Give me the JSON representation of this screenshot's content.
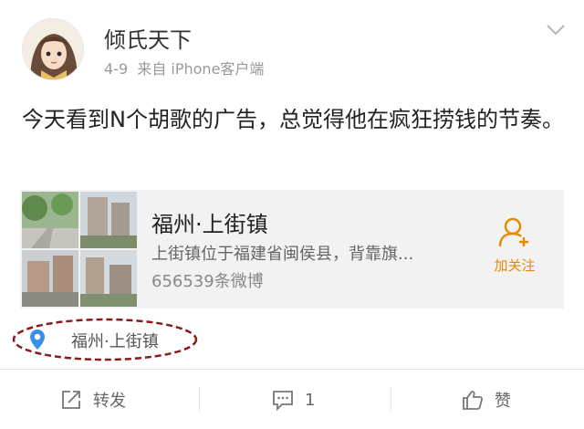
{
  "post": {
    "username": "倾氏天下",
    "date": "4-9",
    "source": "来自 iPhone客户端",
    "text": "今天看到N个胡歌的广告，总觉得他在疯狂捞钱的节奏。",
    "more_icon": "chevron-down-icon"
  },
  "card": {
    "title": "福州·上街镇",
    "description": "上街镇位于福建省闽侯县，背靠旗...",
    "count": "656539条微博",
    "follow_label": "加关注",
    "follow_icon": "add-user-icon"
  },
  "location": {
    "label": "福州·上街镇",
    "icon": "location-pin-icon",
    "highlight_color": "#8b1a1a"
  },
  "actions": {
    "repost_label": "转发",
    "comment_count": "1",
    "like_label": "赞"
  },
  "colors": {
    "accent": "#e68a00",
    "pin": "#3a8ee6",
    "card_bg": "#f2f2f2"
  }
}
